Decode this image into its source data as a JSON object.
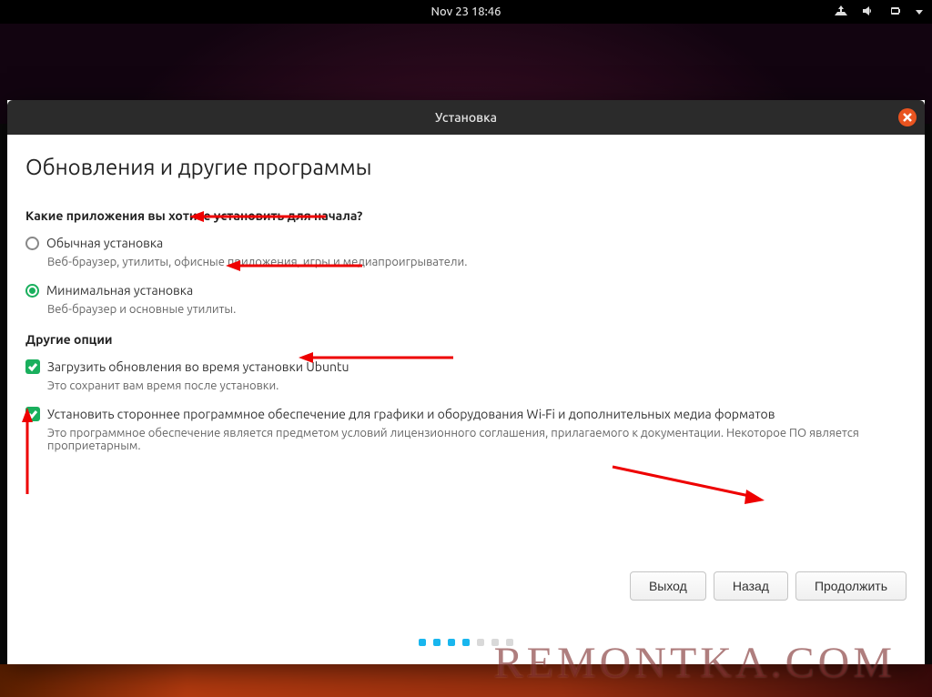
{
  "topbar": {
    "clock": "Nov 23  18:46"
  },
  "window": {
    "title": "Установка"
  },
  "page": {
    "heading": "Обновления и другие программы",
    "question": "Какие приложения вы хотите установить для начала?",
    "radios": [
      {
        "label": "Обычная установка",
        "desc": "Веб-браузер, утилиты, офисные приложения, игры и медиапроигрыватели.",
        "checked": false
      },
      {
        "label": "Минимальная установка",
        "desc": "Веб-браузер и основные утилиты.",
        "checked": true
      }
    ],
    "other_section": "Другие опции",
    "checks": [
      {
        "label": "Загрузить обновления во время установки Ubuntu",
        "desc": "Это сохранит вам время после установки.",
        "checked": true
      },
      {
        "label": "Установить стороннее программное обеспечение для графики и оборудования Wi-Fi и дополнительных медиа форматов",
        "desc": "Это программное обеспечение является предметом условий лицензионного соглашения, прилагаемого к документации. Некоторое ПО является проприетарным.",
        "checked": true
      }
    ],
    "buttons": {
      "quit": "Выход",
      "back": "Назад",
      "continue": "Продолжить"
    },
    "progress": {
      "total": 7,
      "current": 4
    }
  },
  "watermark": "REMONTKA.COM"
}
